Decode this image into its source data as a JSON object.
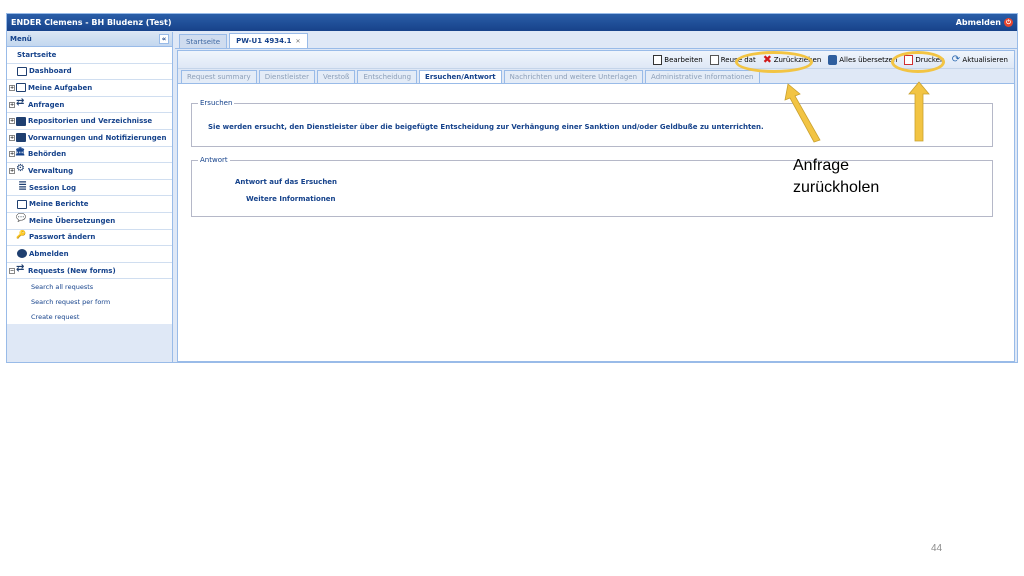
{
  "window": {
    "title": "ENDER Clemens - BH Bludenz (Test)",
    "logout_label": "Abmelden"
  },
  "sidebar": {
    "header": "Menü",
    "collapse": "«",
    "items": [
      {
        "label": "Startseite"
      },
      {
        "label": "Dashboard"
      },
      {
        "label": "Meine Aufgaben"
      },
      {
        "label": "Anfragen"
      },
      {
        "label": "Repositorien und Verzeichnisse"
      },
      {
        "label": "Vorwarnungen und Notifizierungen"
      },
      {
        "label": "Behörden"
      },
      {
        "label": "Verwaltung"
      },
      {
        "label": "Session Log"
      },
      {
        "label": "Meine Berichte"
      },
      {
        "label": "Meine Übersetzungen"
      },
      {
        "label": "Passwort ändern"
      },
      {
        "label": "Abmelden"
      },
      {
        "label": "Requests (New forms)"
      }
    ],
    "subitems": [
      {
        "label": "Search all requests"
      },
      {
        "label": "Search request per form"
      },
      {
        "label": "Create request"
      }
    ]
  },
  "doc_tabs": [
    {
      "label": "Startseite"
    },
    {
      "label": "PW-U1 4934.1"
    }
  ],
  "toolbar": {
    "edit": "Bearbeiten",
    "reuse": "Reuse dat",
    "withdraw": "Zurückziehen",
    "translate_all": "Alles übersetzen",
    "print": "Drucken",
    "refresh": "Aktualisieren"
  },
  "sub_tabs": [
    {
      "label": "Request summary"
    },
    {
      "label": "Dienstleister"
    },
    {
      "label": "Verstoß"
    },
    {
      "label": "Entscheidung"
    },
    {
      "label": "Ersuchen/Antwort"
    },
    {
      "label": "Nachrichten und weitere Unterlagen"
    },
    {
      "label": "Administrative Informationen"
    }
  ],
  "ersuchen": {
    "legend": "Ersuchen",
    "text": "Sie werden ersucht, den Dienstleister über die beigefügte Entscheidung zur Verhängung einer Sanktion und/oder Geldbuße zu unterrichten."
  },
  "antwort": {
    "legend": "Antwort",
    "link1": "Antwort auf das Ersuchen",
    "link2": "Weitere Informationen"
  },
  "annotation": {
    "line1": "Anfrage",
    "line2": "zurückholen"
  },
  "page_number": "44",
  "colors": {
    "highlight": "#f2c443",
    "arrow": "#f2c443",
    "titlebar": "#17428a"
  }
}
